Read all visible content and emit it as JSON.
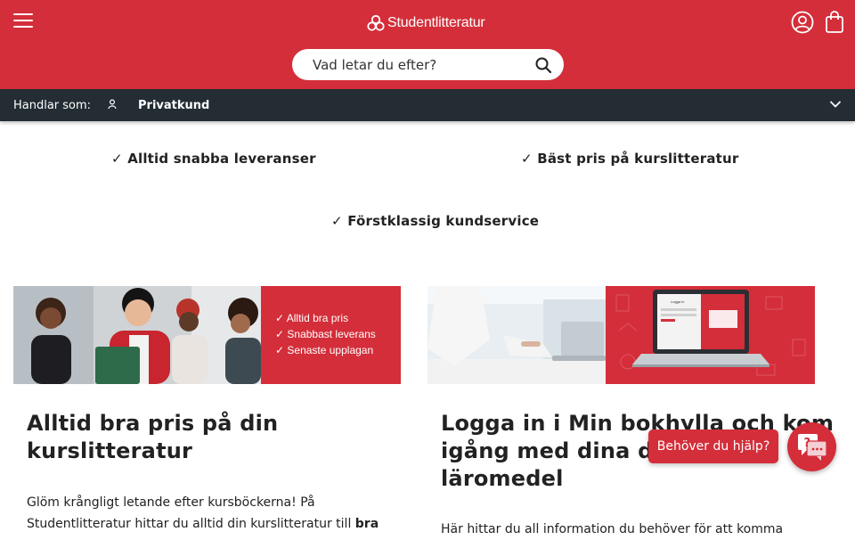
{
  "header": {
    "brand": "Studentlitteratur",
    "brand_color": "#d42e3a",
    "icons": [
      "hamburger-menu-icon",
      "account-icon",
      "shopping-bag-icon",
      "search-icon"
    ]
  },
  "search": {
    "placeholder": "Vad letar du efter?"
  },
  "shopping_as": {
    "label": "Handlar som:",
    "value": "Privatkund",
    "bar_color": "#232d33"
  },
  "usps": [
    "✓ Alltid snabba leveranser",
    "✓ Bäst pris på kurslitteratur",
    "✓ Förstklassig kundservice"
  ],
  "cards": [
    {
      "banner_lines": [
        "✓ Alltid bra pris",
        "✓ Snabbast leverans",
        "✓ Senaste upplagan"
      ],
      "title_lines": [
        "Alltid bra pris på din",
        "kurslitteratur"
      ],
      "text_line1": "Glöm krångligt letande efter kursböckerna! På",
      "text_line2": "Studentlitteratur hittar du alltid din kurslitteratur till",
      "text_bold": "bra"
    },
    {
      "screen_title": "Logga in",
      "title_lines": [
        "Logga in i Min bokhylla och kom",
        "igång med dina dig",
        "läromedel"
      ],
      "text_line1": "Här hittar du all information du behöver för att komma"
    }
  ],
  "help": {
    "button_label": "Behöver du hjälp?",
    "icon_symbol": "?"
  }
}
